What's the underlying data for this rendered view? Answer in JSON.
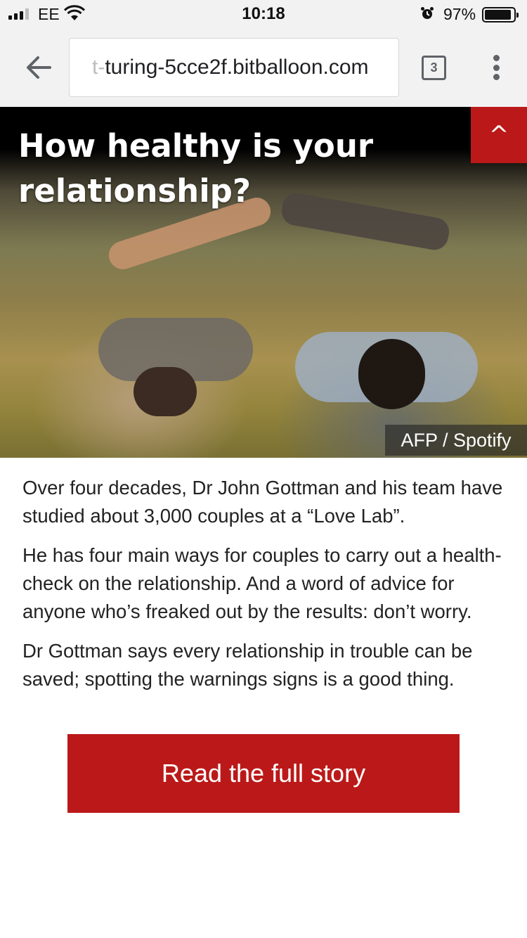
{
  "status_bar": {
    "carrier": "EE",
    "time": "10:18",
    "battery_percent": "97%",
    "battery_level": 0.97,
    "icons": [
      "signal-icon",
      "wifi-icon",
      "alarm-icon",
      "battery-icon"
    ]
  },
  "browser": {
    "url_faded": "t-",
    "url": "turing-5cce2f.bitballoon.com",
    "tab_count": "3",
    "icons": [
      "back-arrow-icon",
      "tabs-icon",
      "more-vert-icon"
    ]
  },
  "hero": {
    "title": "How healthy is your relationship?",
    "collapse_symbol": "^",
    "image_credit": "AFP / Spotify",
    "colors": {
      "accent": "#bb1919"
    }
  },
  "article": {
    "paragraphs": [
      "Over four decades, Dr John Gottman and his team have studied about 3,000 couples at a “Love Lab”.",
      "He has four main ways for couples to carry out a health-check on the relationship. And a word of advice for anyone who’s freaked out by the results: don’t worry.",
      "Dr Gottman says every relationship in trouble can be saved; spotting the warnings signs is a good thing."
    ],
    "cta_label": "Read the full story"
  }
}
